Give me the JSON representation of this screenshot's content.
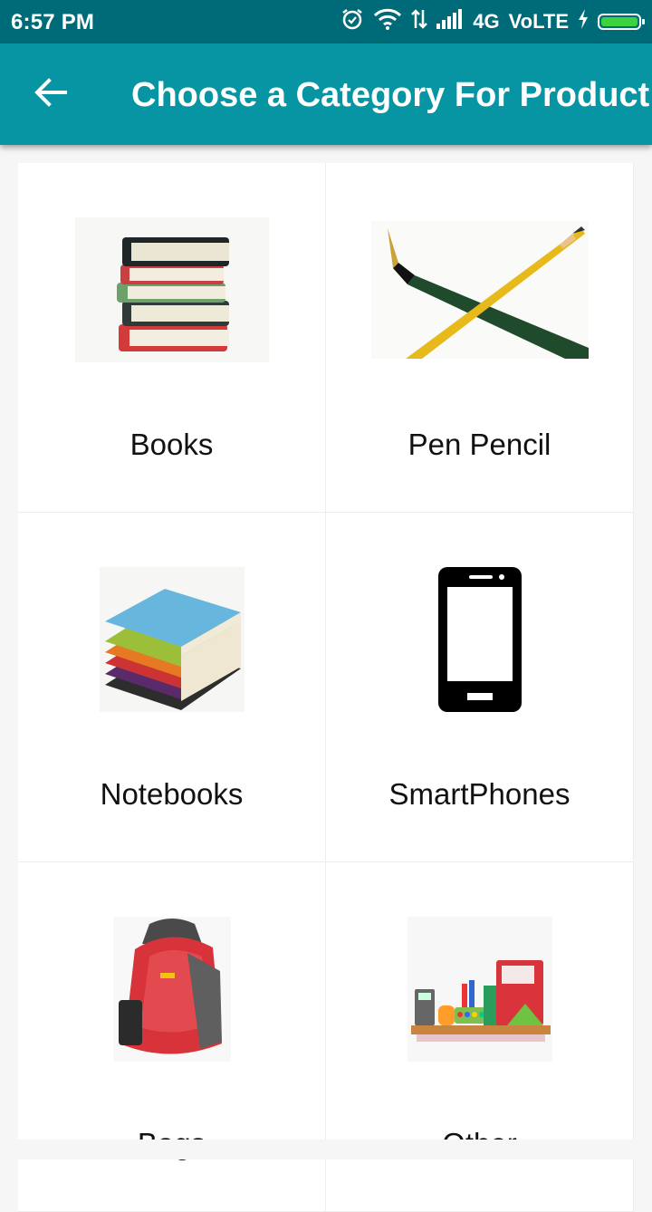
{
  "status_bar": {
    "time": "6:57 PM",
    "network": "4G",
    "volte": "VoLTE",
    "battery_level": 1.0
  },
  "app_bar": {
    "title": "Choose a Category For Product",
    "back_icon": "arrow-back-icon"
  },
  "categories": [
    {
      "label": "Books",
      "icon": "book-stack-image"
    },
    {
      "label": "Pen Pencil",
      "icon": "pen-pencil-image"
    },
    {
      "label": "Notebooks",
      "icon": "notebook-stack-image"
    },
    {
      "label": "SmartPhones",
      "icon": "smartphone-icon"
    },
    {
      "label": "Bags",
      "icon": "backpack-image"
    },
    {
      "label": "Other",
      "icon": "stationery-shelf-image"
    }
  ],
  "colors": {
    "status_bar": "#006b78",
    "app_bar": "#0795a3",
    "background": "#f6f6f6"
  }
}
